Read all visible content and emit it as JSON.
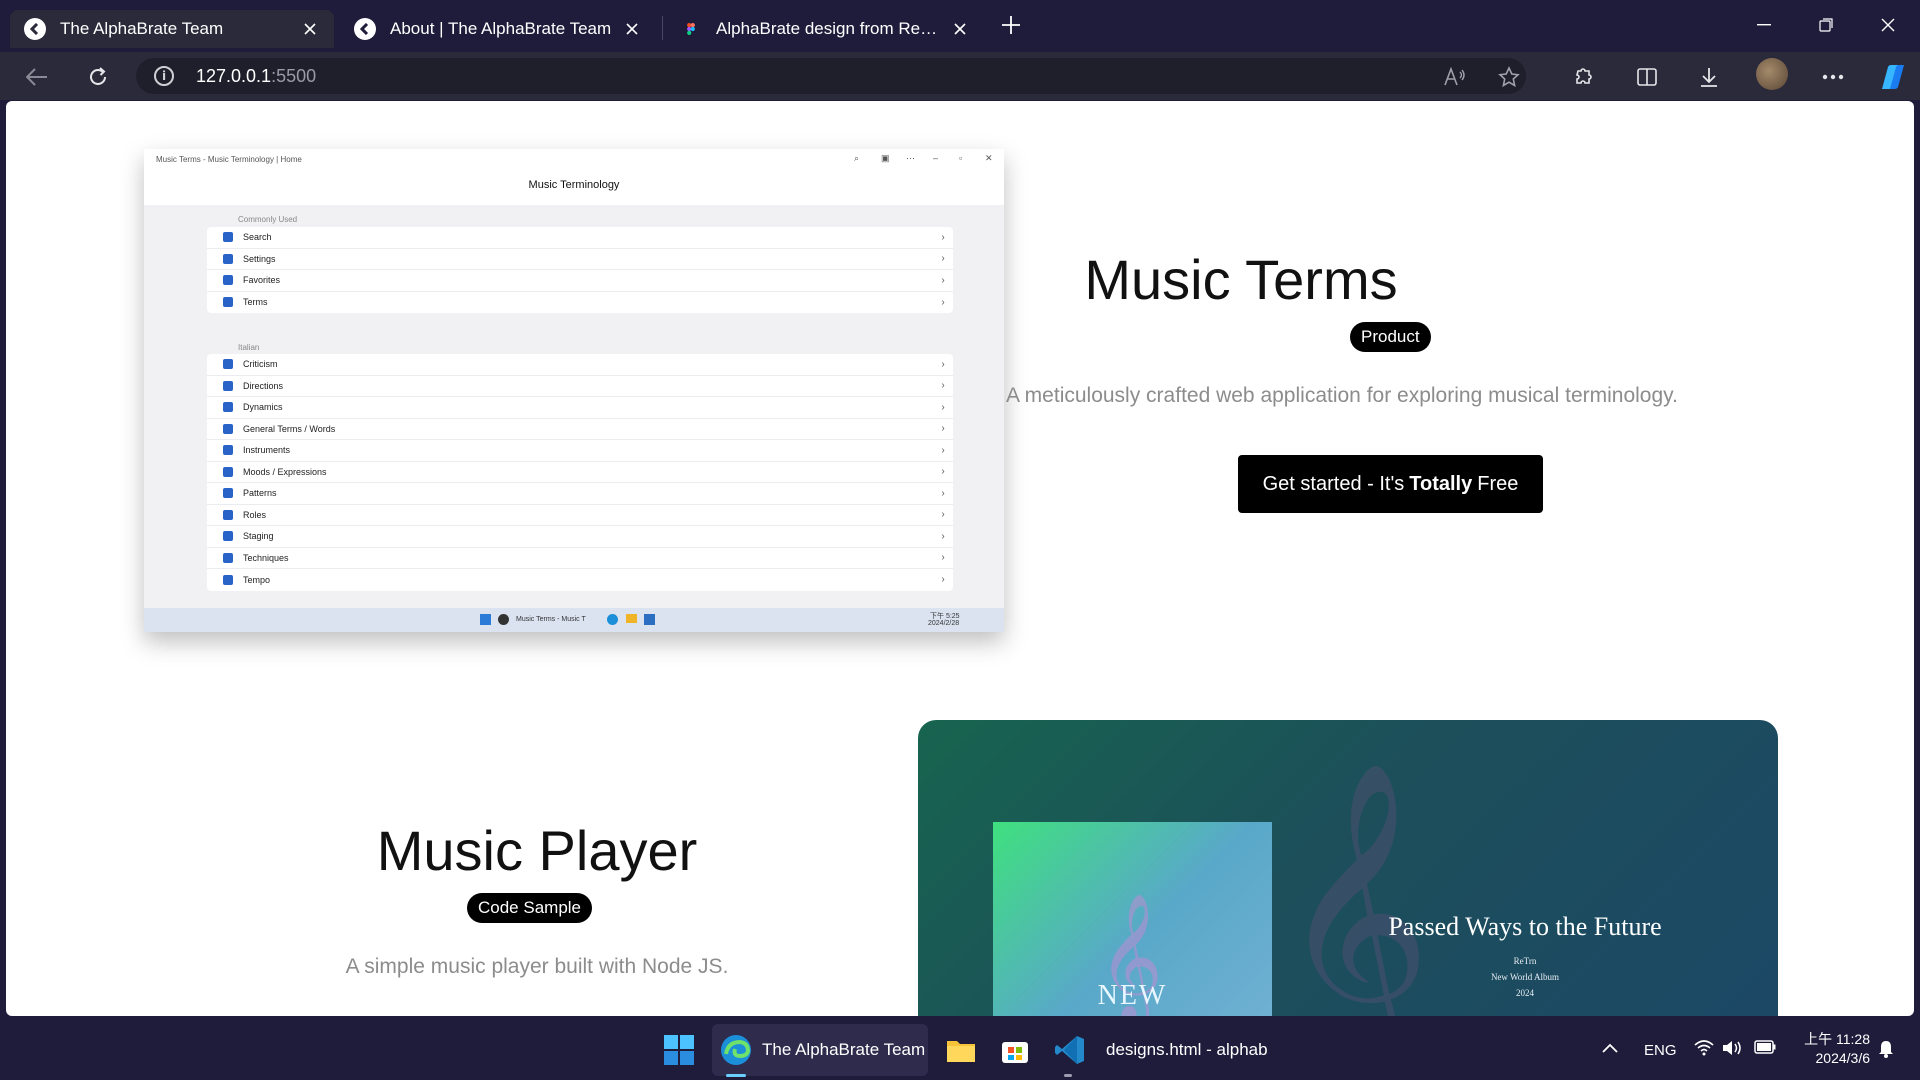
{
  "browser": {
    "tabs": [
      {
        "title": "The AlphaBrate Team",
        "active": true
      },
      {
        "title": "About | The AlphaBrate Team",
        "active": false
      },
      {
        "title": "AlphaBrate design from ReTrn – F",
        "active": false
      }
    ],
    "address": {
      "host": "127.0.0.1",
      "port": ":5500"
    },
    "icons": [
      "back-icon",
      "refresh-icon",
      "info-icon",
      "read-aloud-icon",
      "favorite-star-icon",
      "extensions-icon",
      "split-screen-icon",
      "download-icon",
      "more-icon",
      "copilot-icon"
    ]
  },
  "product_section": {
    "title": "Music Terms",
    "badge": "Product",
    "description": "A meticulously crafted web application for exploring musical terminology.",
    "cta": {
      "prefix": "Get started - It's",
      "emphasis": "Totally",
      "suffix": "Free"
    }
  },
  "product_screenshot": {
    "window_title": "Music Terms - Music Terminology | Home",
    "heading": "Music Terminology",
    "sections": [
      {
        "label": "Commonly Used",
        "items": [
          "Search",
          "Settings",
          "Favorites",
          "Terms"
        ]
      },
      {
        "label": "Italian",
        "items": [
          "Criticism",
          "Directions",
          "Dynamics",
          "General Terms / Words",
          "Instruments",
          "Moods / Expressions",
          "Patterns",
          "Roles",
          "Staging",
          "Techniques",
          "Tempo"
        ]
      }
    ],
    "taskbar_app": "Music Terms - Music T",
    "taskbar_time": "下午 5:25",
    "taskbar_date": "2024/2/28"
  },
  "player_section": {
    "title": "Music Player",
    "badge": "Code Sample",
    "description": "A simple music player built with Node JS.",
    "cover_label": "NEW",
    "album_title": "Passed Ways to the Future",
    "album_artist": "ReTrn",
    "album_subtitle": "New World Album",
    "album_year": "2024"
  },
  "taskbar": {
    "edge_window": "The AlphaBrate Team",
    "vscode_window": "designs.html - alphab",
    "language": "ENG",
    "time": "上午 11:28",
    "date": "2024/3/6"
  },
  "colors": {
    "page_bg": "#ffffff",
    "chrome_bg": "#1f1c3b",
    "toolbar_bg": "#2a2a3a",
    "accent_blue": "#2a63c7",
    "player_green": "#17644f"
  }
}
